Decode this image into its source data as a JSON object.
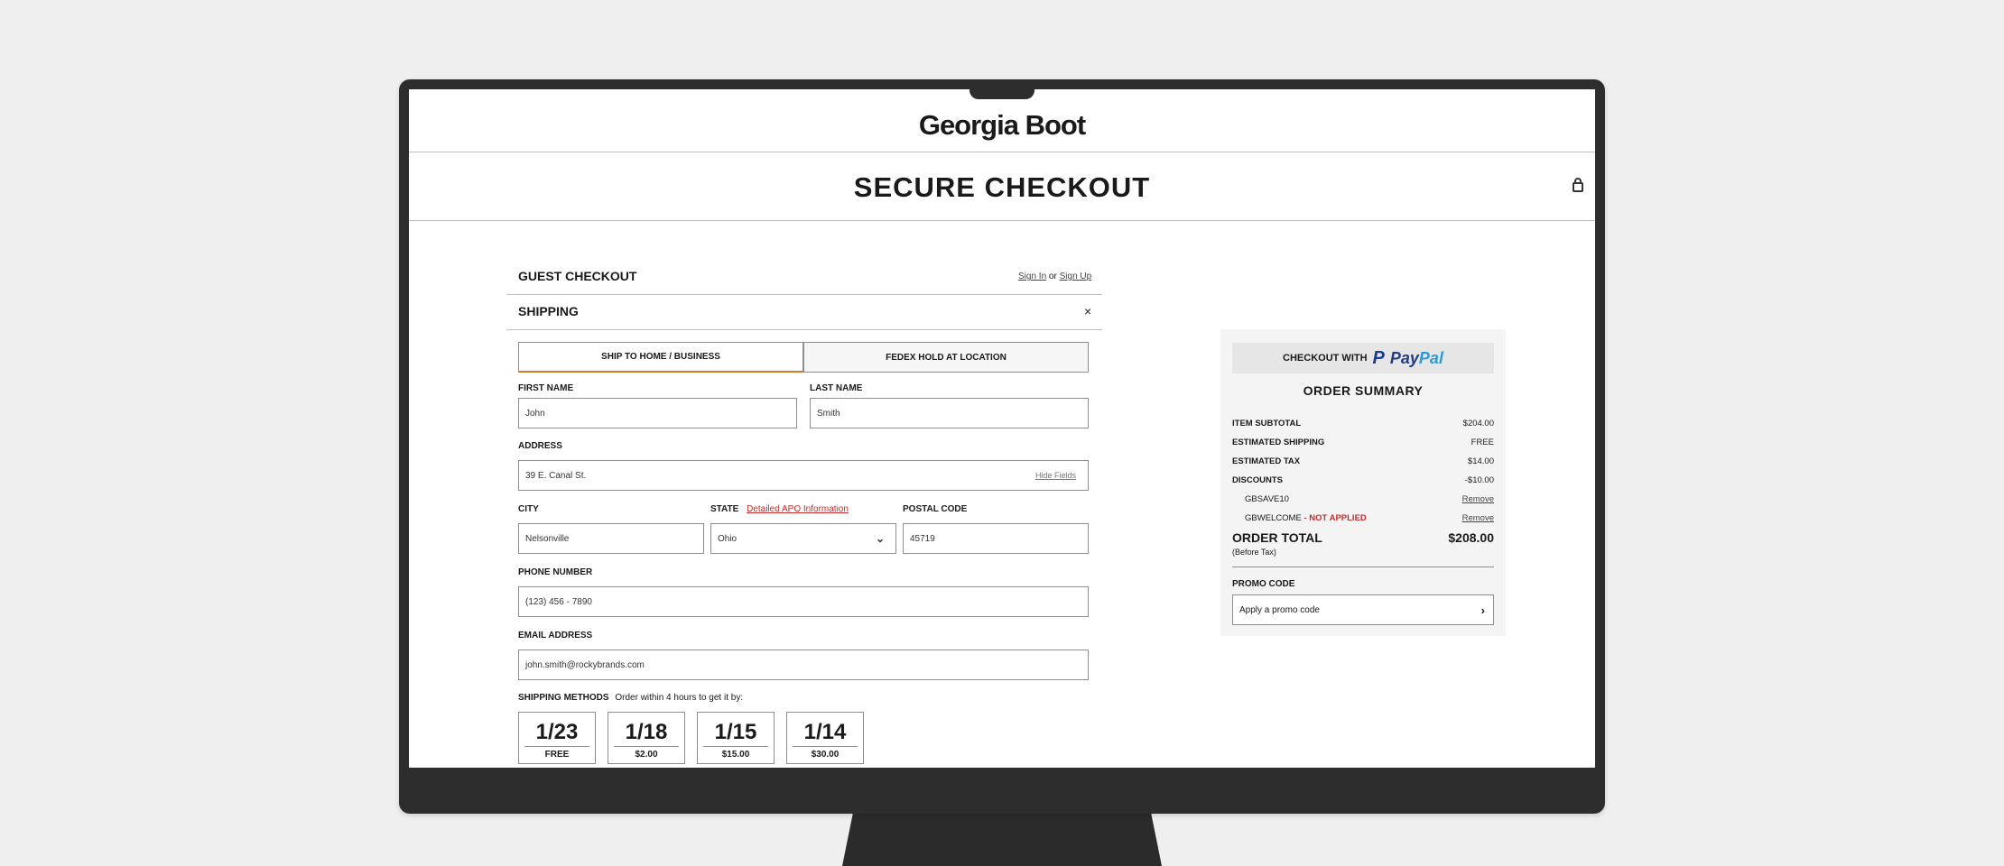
{
  "brand": "Georgia Boot",
  "page_title": "SECURE CHECKOUT",
  "icons": {
    "lock": "lock-icon",
    "close": "close-icon",
    "chevron_down": "chevron-down-icon",
    "chevron_right": "chevron-right-icon",
    "apple": "apple-logo-icon"
  },
  "colors": {
    "accent_tab": "#d27a2c",
    "alert": "#c52b2b",
    "paypal_dark": "#243c82",
    "paypal_light": "#2d9ad6"
  },
  "guest": {
    "title": "GUEST CHECKOUT",
    "sign_in": "Sign In",
    "or": "or",
    "sign_up": "Sign Up"
  },
  "shipping": {
    "title": "SHIPPING",
    "tabs": [
      "SHIP TO HOME /  BUSINESS",
      "FEDEX HOLD AT LOCATION"
    ],
    "first_name": {
      "label": "FIRST NAME",
      "value": "John"
    },
    "last_name": {
      "label": "LAST NAME",
      "value": "Smith"
    },
    "address": {
      "label": "ADDRESS",
      "value": "39 E. Canal St.",
      "hide_fields": "Hide Fields"
    },
    "city": {
      "label": "CITY",
      "value": "Nelsonville"
    },
    "state": {
      "label": "STATE",
      "value": "Ohio",
      "apo_link": "Detailed APO Information"
    },
    "postal": {
      "label": "POSTAL CODE",
      "value": "45719"
    },
    "phone": {
      "label": "PHONE NUMBER",
      "value": "(123) 456 - 7890"
    },
    "email": {
      "label": "EMAIL ADDRESS",
      "value": "john.smith@rockybrands.com"
    },
    "methods": {
      "label": "SHIPPING METHODS",
      "note": "Order within 4 hours to get it by:",
      "options": [
        {
          "date": "1/23",
          "price": "FREE"
        },
        {
          "date": "1/18",
          "price": "$2.00"
        },
        {
          "date": "1/15",
          "price": "$15.00"
        },
        {
          "date": "1/14",
          "price": "$30.00"
        }
      ]
    }
  },
  "summary": {
    "paypal_prefix": "CHECKOUT WITH",
    "paypal_word_a": "Pay",
    "paypal_word_b": "Pal",
    "title": "ORDER SUMMARY",
    "rows": [
      {
        "label": "ITEM SUBTOTAL",
        "value": "$204.00"
      },
      {
        "label": "ESTIMATED SHIPPING",
        "value": "FREE"
      },
      {
        "label": "ESTIMATED TAX",
        "value": "$14.00"
      },
      {
        "label": "DISCOUNTS",
        "value": "-$10.00"
      }
    ],
    "codes": [
      {
        "code": "GBSAVE10",
        "status": "",
        "action": "Remove"
      },
      {
        "code": "GBWELCOME",
        "status": "- NOT APPLIED",
        "action": "Remove"
      }
    ],
    "total_label": "ORDER TOTAL",
    "total_value": "$208.00",
    "before_tax": "(Before Tax)",
    "promo_label": "PROMO CODE",
    "promo_placeholder": "Apply a promo code"
  }
}
